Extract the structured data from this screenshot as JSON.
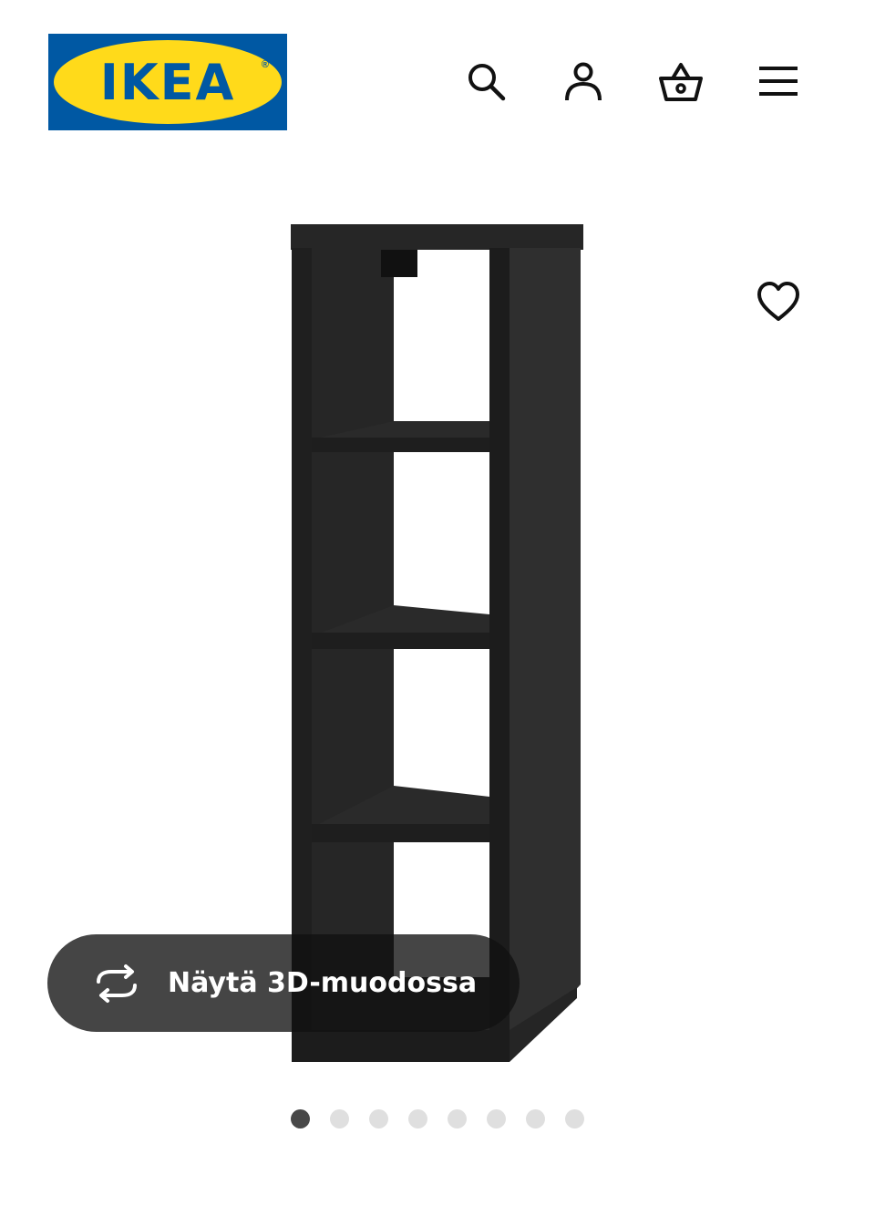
{
  "header": {
    "logo_text": "IKEA",
    "logo_registered": "®",
    "icons": [
      "search-icon",
      "user-icon",
      "basket-icon",
      "menu-icon"
    ]
  },
  "product": {
    "image_alt": "Hyllykkö",
    "view_3d_label": "Näytä 3D-muodossa",
    "view_3d_icon": "rotate-3d-icon",
    "favourite_icon": "heart-icon"
  },
  "gallery": {
    "slide_count": 8,
    "active_index": 0
  },
  "colors": {
    "brand_blue": "#0058a3",
    "brand_yellow": "#ffda1a",
    "shelf_color": "#2b2b2b",
    "dot_active": "#484848",
    "dot_inactive": "#dfdfdf"
  }
}
